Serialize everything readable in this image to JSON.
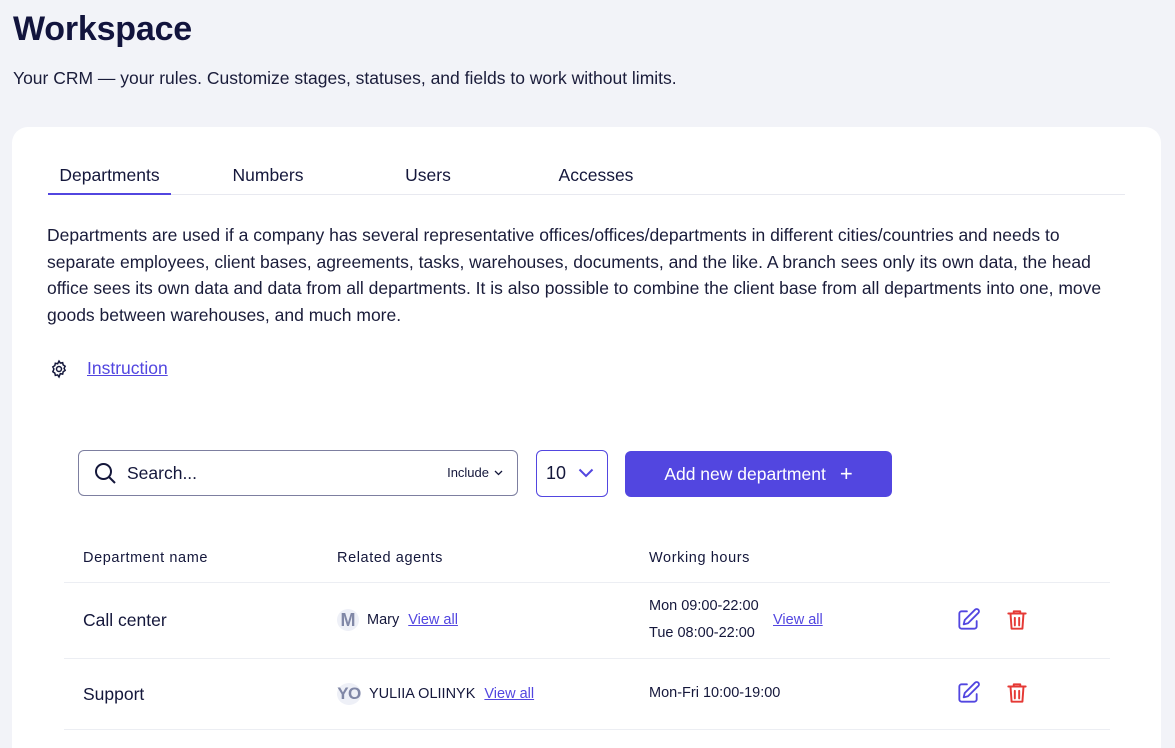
{
  "header": {
    "title": "Workspace",
    "subtitle": "Your CRM — your rules. Customize stages, statuses, and fields to work without limits."
  },
  "tabs": [
    {
      "label": "Departments",
      "active": true
    },
    {
      "label": "Numbers",
      "active": false
    },
    {
      "label": "Users",
      "active": false
    },
    {
      "label": "Accesses",
      "active": false
    }
  ],
  "description": "Departments are used if a company has several representative offices/offices/departments in different cities/countries and needs to separate employees, client bases, agreements, tasks, warehouses, documents, and the like. A branch sees only its own data, the head office sees its own data and data from all departments. It is also possible to combine the client base from all departments into one, move goods between warehouses, and much more.",
  "instruction": {
    "label": "Instruction",
    "icon": "gear-icon"
  },
  "toolbar": {
    "search_placeholder": "Search...",
    "include_label": "Include",
    "page_size": "10",
    "add_button_label": "Add new department",
    "add_button_icon": "+"
  },
  "table": {
    "columns": [
      "Department name",
      "Related agents",
      "Working hours"
    ],
    "rows": [
      {
        "name": "Call center",
        "agent_initials": "M",
        "agent_name": "Mary",
        "agents_view_all": "View all",
        "hours": [
          "Mon 09:00-22:00",
          "Tue 08:00-22:00"
        ],
        "hours_view_all": "View all"
      },
      {
        "name": "Support",
        "agent_initials": "YO",
        "agent_name": "YULIIA OLIINYK",
        "agents_view_all": "View all",
        "hours": [
          "Mon-Fri 10:00-19:00"
        ]
      }
    ]
  },
  "colors": {
    "accent": "#5246e0",
    "danger": "#e53935",
    "text": "#14173b",
    "background": "#f2f3f8"
  }
}
